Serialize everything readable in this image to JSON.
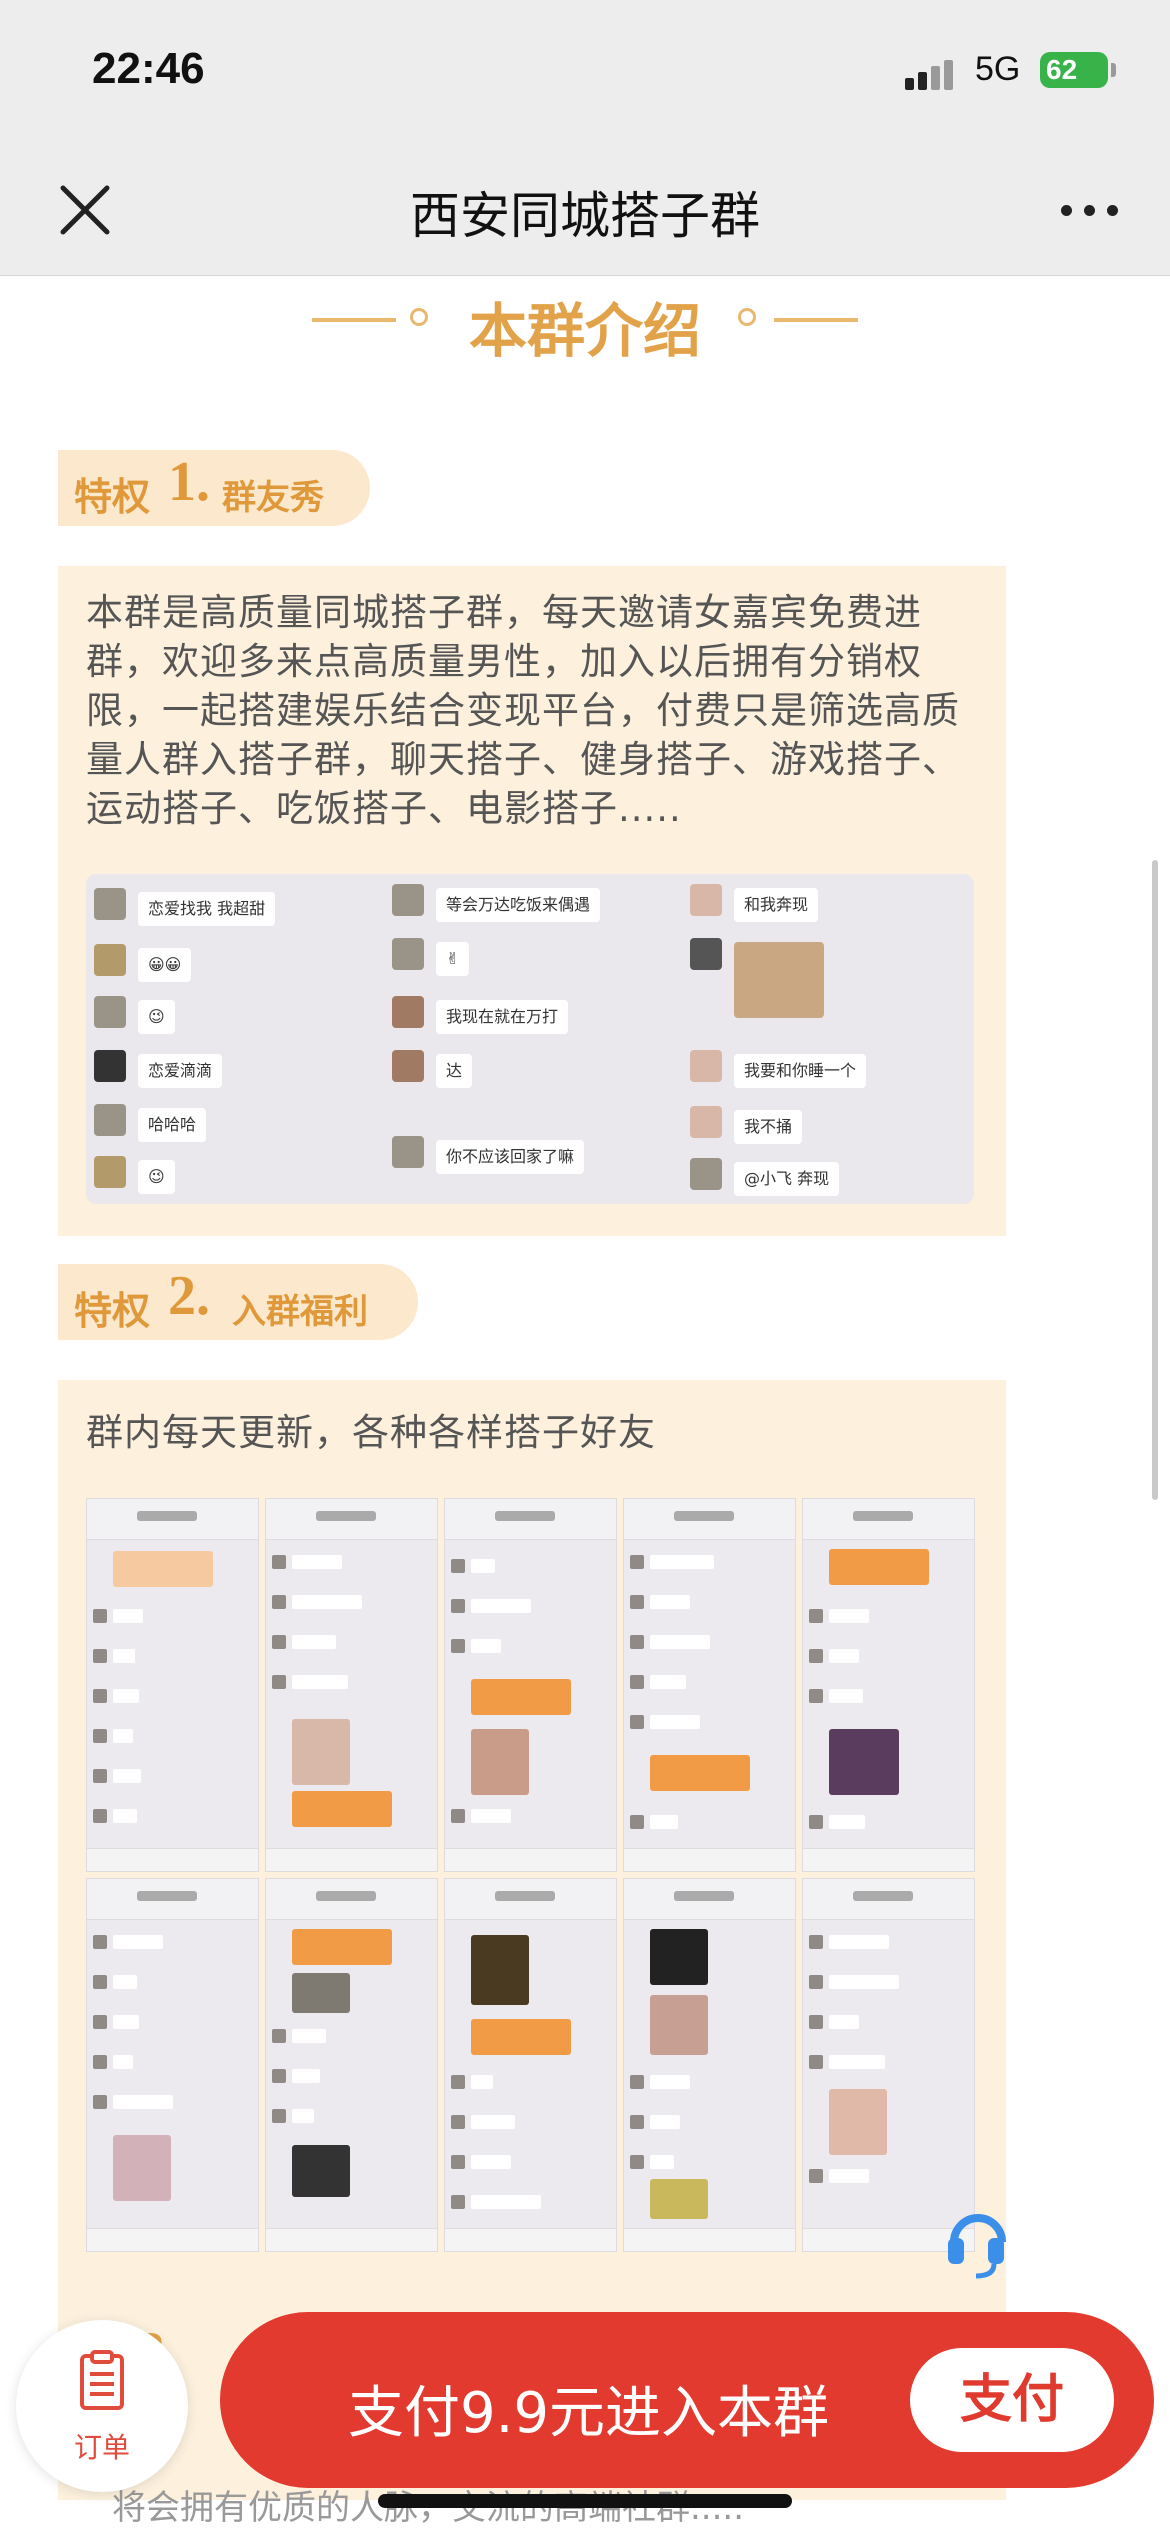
{
  "status_bar": {
    "time": "22:46",
    "network": "5G",
    "battery": "62"
  },
  "nav": {
    "title": "西安同城搭子群"
  },
  "intro": {
    "title": "本群介绍"
  },
  "section1": {
    "label": "特权",
    "number": "1.",
    "subtitle": "群友秀",
    "description": "本群是高质量同城搭子群，每天邀请女嘉宾免费进群，欢迎多来点高质量男性，加入以后拥有分销权限，一起搭建娱乐结合变现平台，付费只是筛选高质量人群入搭子群，聊天搭子、健身搭子、游戏搭子、运动搭子、吃饭搭子、电影搭子.....",
    "chat_columns": [
      [
        "恋爱找我 我超甜",
        "😀😀",
        "😉",
        "恋爱滴滴",
        "哈哈哈",
        "😉"
      ],
      [
        "等会万达吃饭来偶遇",
        "✌",
        "我现在就在万打",
        "达",
        "你不应该回家了嘛"
      ],
      [
        "和我奔现",
        "",
        "我要和你睡一个",
        "我不捅",
        "@小飞 奔现"
      ]
    ]
  },
  "section2": {
    "label": "特权",
    "number": "2.",
    "subtitle": "入群福利",
    "description": "群内每天更新，各种各样搭子好友"
  },
  "section3": {
    "number": "3",
    "description": "将会拥有优质的人脉，交流的高端社群....."
  },
  "bottom_bar": {
    "order_label": "订单",
    "pay_text": "支付9.9元进入本群",
    "pay_button": "支付"
  },
  "colors": {
    "accent": "#e2a24a",
    "pay_red": "#e23a2f",
    "panel_bg": "#fdf1de"
  }
}
